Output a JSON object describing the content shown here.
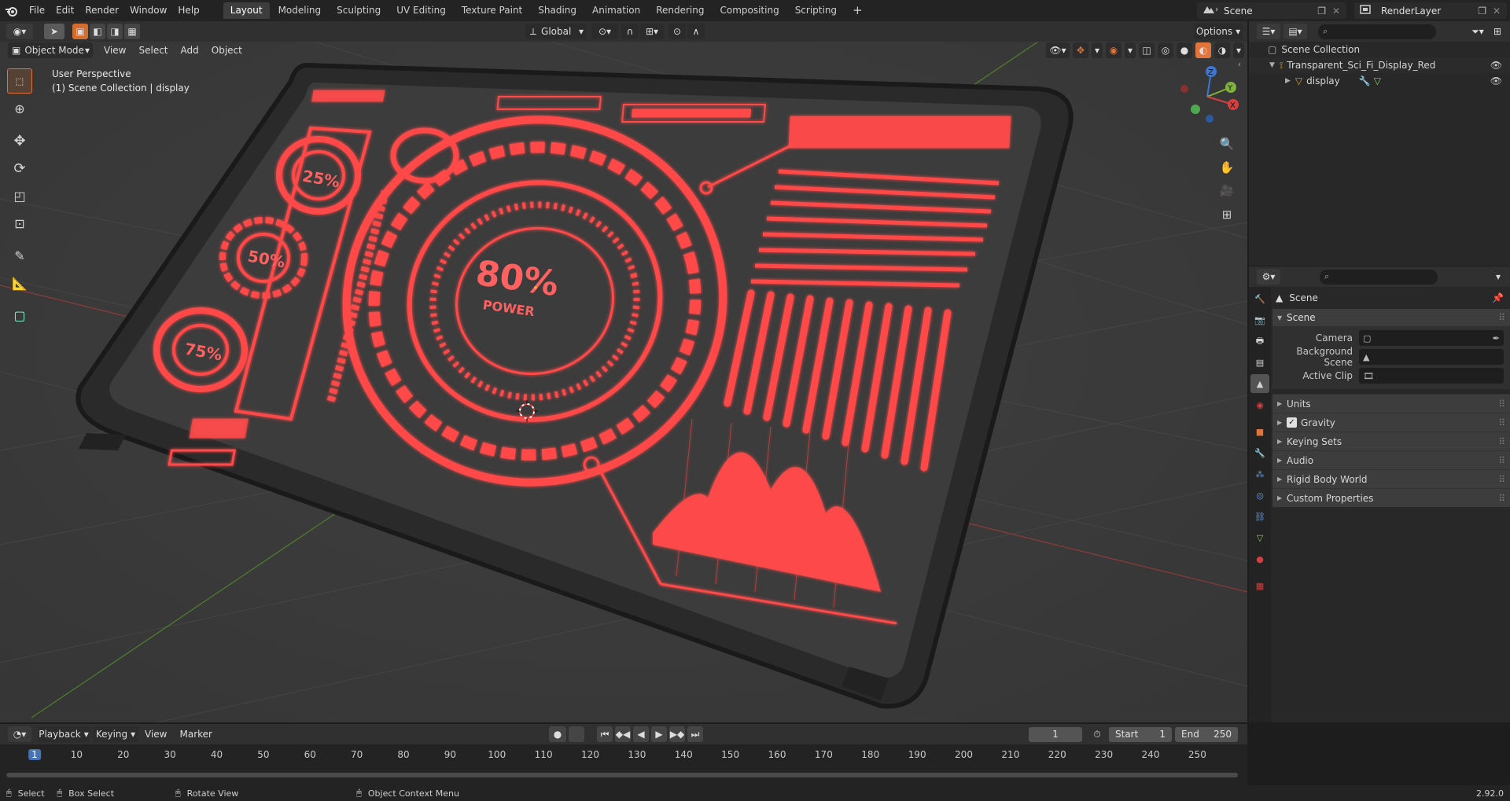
{
  "menu": [
    "File",
    "Edit",
    "Render",
    "Window",
    "Help"
  ],
  "workspaces": [
    {
      "label": "Layout",
      "active": true
    },
    {
      "label": "Modeling",
      "active": false
    },
    {
      "label": "Sculpting",
      "active": false
    },
    {
      "label": "UV Editing",
      "active": false
    },
    {
      "label": "Texture Paint",
      "active": false
    },
    {
      "label": "Shading",
      "active": false
    },
    {
      "label": "Animation",
      "active": false
    },
    {
      "label": "Rendering",
      "active": false
    },
    {
      "label": "Compositing",
      "active": false
    },
    {
      "label": "Scripting",
      "active": false
    }
  ],
  "add_workspace_icon": "+",
  "scene_selector": {
    "value": "Scene"
  },
  "view_layer_selector": {
    "value": "RenderLayer"
  },
  "viewport_header": {
    "mode": "Object Mode",
    "menus": [
      "View",
      "Select",
      "Add",
      "Object"
    ],
    "transform_orientation": "Global",
    "options_label": "Options"
  },
  "viewport_overlay": {
    "view_name": "User Perspective",
    "collection_info": "(1) Scene Collection | display"
  },
  "hud_text": {
    "percent_main": "80%",
    "power": "POWER",
    "p25": "25%",
    "p50": "50%",
    "p75": "75%"
  },
  "gizmo_axes": {
    "x": "X",
    "y": "Y",
    "z": "Z"
  },
  "outliner": {
    "items": [
      {
        "label": "Scene Collection",
        "level": 0,
        "icon": "collection-icon"
      },
      {
        "label": "Transparent_Sci_Fi_Display_Red",
        "level": 1,
        "icon": "armature-icon"
      },
      {
        "label": "display",
        "level": 2,
        "icon": "mesh-icon"
      }
    ]
  },
  "properties": {
    "breadcrumb": "Scene",
    "panel_title": "Scene",
    "fields": [
      {
        "label": "Camera"
      },
      {
        "label": "Background Scene"
      },
      {
        "label": "Active Clip"
      }
    ],
    "subpanels": [
      {
        "label": "Units",
        "checkbox": false
      },
      {
        "label": "Gravity",
        "checkbox": true
      },
      {
        "label": "Keying Sets",
        "checkbox": false
      },
      {
        "label": "Audio",
        "checkbox": false
      },
      {
        "label": "Rigid Body World",
        "checkbox": false
      },
      {
        "label": "Custom Properties",
        "checkbox": false
      }
    ]
  },
  "timeline": {
    "menus": [
      "Playback",
      "Keying",
      "View",
      "Marker"
    ],
    "current_frame": "1",
    "start_label": "Start",
    "start_value": "1",
    "end_label": "End",
    "end_value": "250",
    "ticks": [
      "1",
      "10",
      "20",
      "30",
      "40",
      "50",
      "60",
      "70",
      "80",
      "90",
      "100",
      "110",
      "120",
      "130",
      "140",
      "150",
      "160",
      "170",
      "180",
      "190",
      "200",
      "210",
      "220",
      "230",
      "240",
      "250"
    ]
  },
  "statusbar": {
    "select": "Select",
    "box_select": "Box Select",
    "rotate_view": "Rotate View",
    "context_menu": "Object Context Menu",
    "version": "2.92.0"
  },
  "colors": {
    "accent": "#e0743a",
    "hud_red": "#ff4a4a",
    "bg": "#3a3a3a"
  }
}
